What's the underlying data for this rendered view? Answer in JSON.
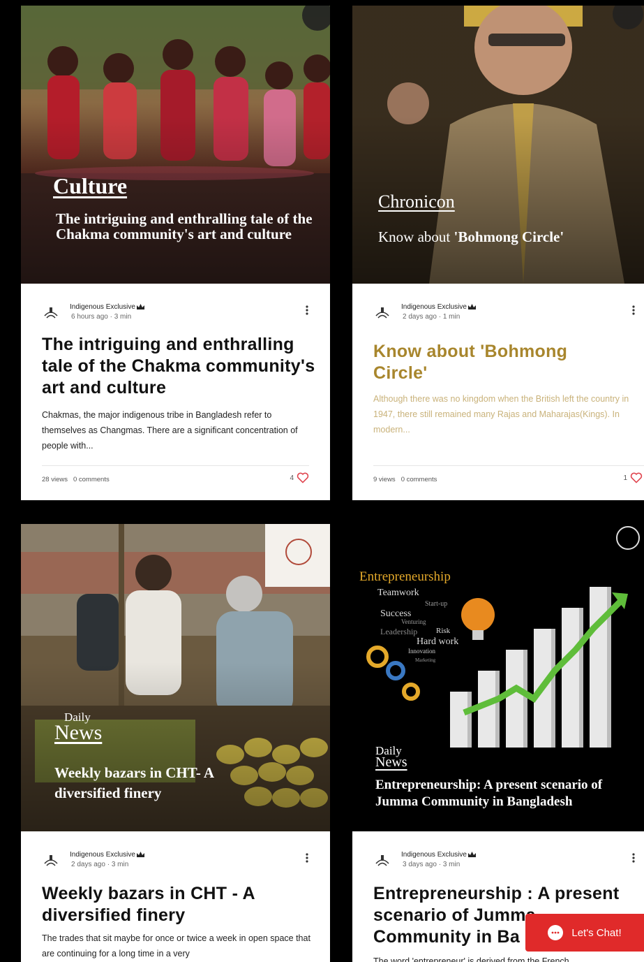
{
  "posts": [
    {
      "image_category": "Culture",
      "image_subtitle": "The intriguing and enthralling tale of the Chakma community's art and culture",
      "author": "Indigenous Exclusive",
      "date": "6 hours ago · 3 min",
      "title": "The intriguing and enthralling tale of the Chakma community's art and culture",
      "excerpt": "Chakmas, the major indigenous tribe in Bangladesh refer to themselves as Changmas. There are a significant concentration of people with...",
      "views": "28 views",
      "comments": "0 comments",
      "likes": "4",
      "icons": {
        "author_logo": "indigenous-logo-icon",
        "menu": "more-options-icon",
        "like": "heart-icon",
        "crown": "crown-icon"
      }
    },
    {
      "image_category": "Chronicon",
      "image_subtitle_prefix": "Know about ",
      "image_subtitle_emph": "'Bohmong Circle'",
      "author": "Indigenous Exclusive",
      "date": "2 days ago · 1 min",
      "title": "Know about 'Bohmong Circle'",
      "excerpt": "Although there was no kingdom when the British left the country in 1947, there still remained many Rajas and Maharajas(Kings). In modern...",
      "views": "9 views",
      "comments": "0 comments",
      "likes": "1"
    },
    {
      "image_category_small": "Daily",
      "image_category": "News",
      "image_subtitle": "Weekly bazars in CHT- A diversified finery",
      "author": "Indigenous Exclusive",
      "date": "2 days ago · 3 min",
      "title": "Weekly bazars in CHT - A diversified finery",
      "excerpt": "The trades that sit maybe for once or twice a week in open space that are continuing for a long time in a very"
    },
    {
      "image_words": [
        "Entrepreneurship",
        "Teamwork",
        "Start-up",
        "Success",
        "Venturing",
        "Leadership",
        "Risk",
        "Hard work",
        "Innovation",
        "Marketing"
      ],
      "image_category_small": "Daily",
      "image_category": "News",
      "image_subtitle": "Entrepreneurship: A present scenario of Jumma Community in Bangladesh",
      "author": "Indigenous Exclusive",
      "date": "3 days ago · 3 min",
      "title": "Entrepreneurship : A present scenario of Jumma Community in Ba",
      "excerpt": "The word 'entrepreneur' is derived from the French"
    }
  ],
  "chat": {
    "label": "Let's Chat!",
    "icon": "chat-bubble-icon",
    "color": "#e02a2a"
  },
  "colors": {
    "gold_title": "#a8862d",
    "like_heart": "#e0454f"
  }
}
